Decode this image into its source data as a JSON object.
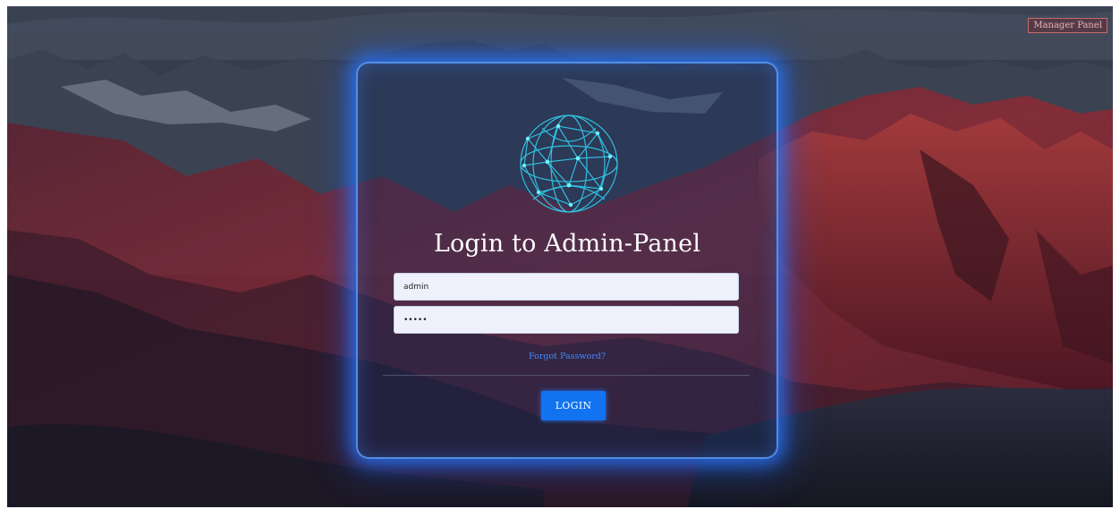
{
  "header": {
    "manager_link_label": "Manager Panel"
  },
  "login": {
    "title": "Login to Admin-Panel",
    "username_value": "admin",
    "password_value": "•••••",
    "forgot_label": "Forgot Password?",
    "submit_label": "LOGIN"
  },
  "icons": {
    "logo": "globe-network-icon"
  },
  "colors": {
    "accent": "#1173f0",
    "glow": "#2f7dff",
    "link": "#3d8bff",
    "logo": "#32c6e6"
  }
}
